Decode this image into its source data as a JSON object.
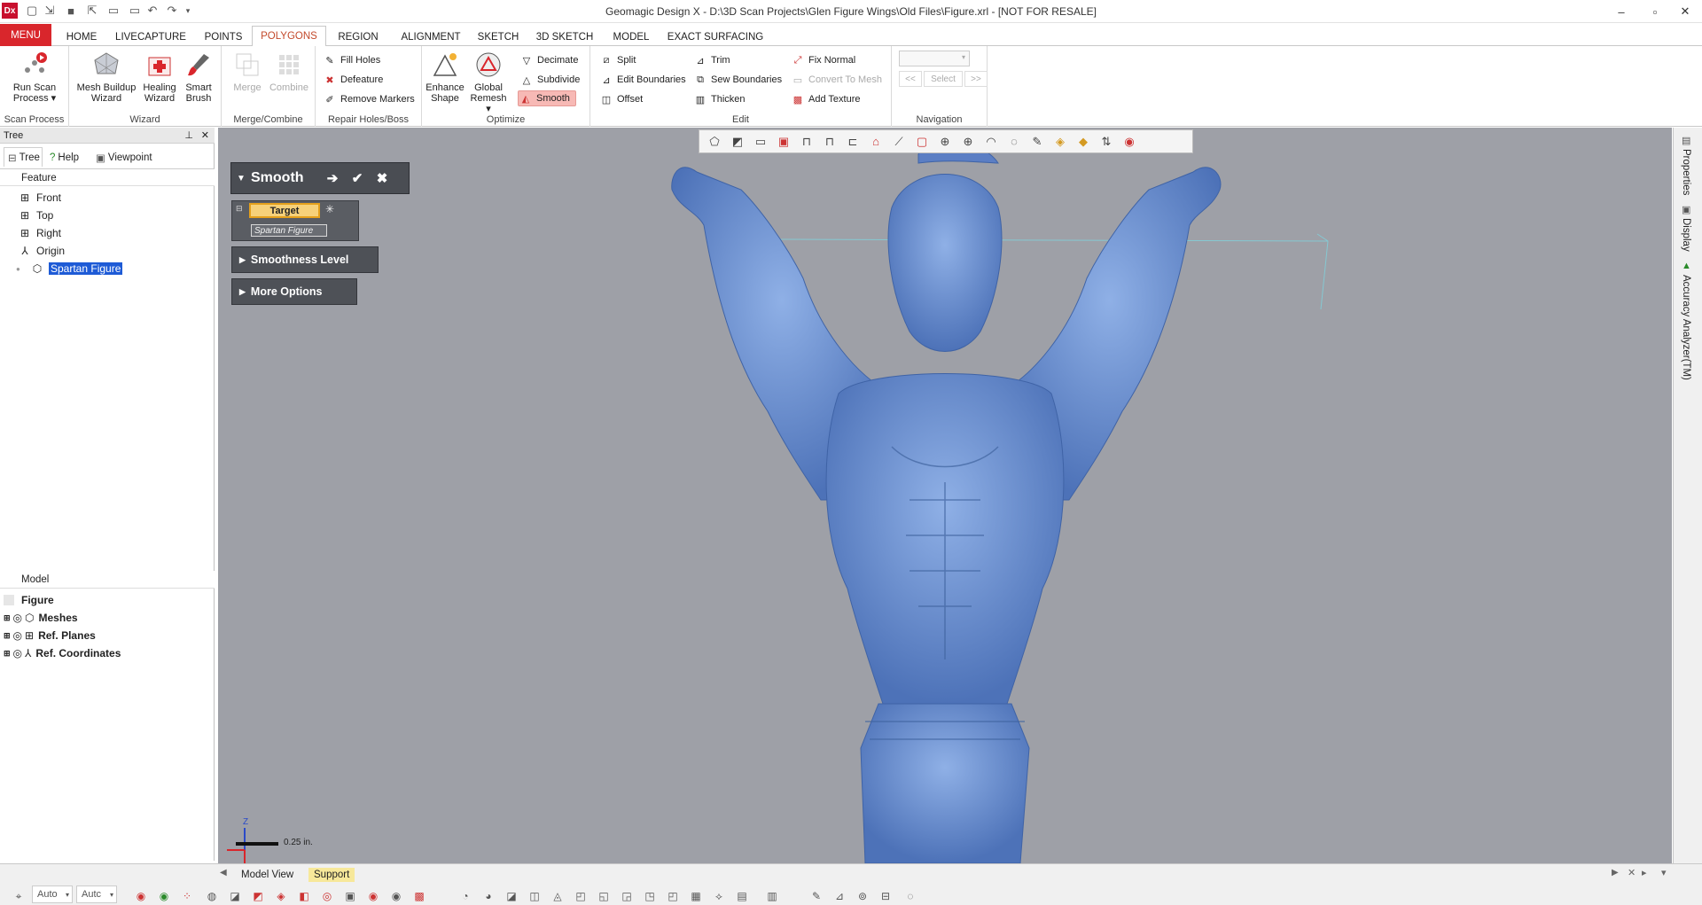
{
  "app": {
    "logo": "Dx",
    "title": "Geomagic Design X - D:\\3D Scan Projects\\Glen Figure Wings\\Old Files\\Figure.xrl - [NOT FOR RESALE]"
  },
  "window": {
    "min": "–",
    "max": "▫",
    "close": "✕"
  },
  "tabs": [
    "MENU",
    "HOME",
    "LIVECAPTURE",
    "POINTS",
    "POLYGONS",
    "REGION",
    "ALIGNMENT",
    "SKETCH",
    "3D SKETCH",
    "MODEL",
    "EXACT SURFACING"
  ],
  "active_tab": "POLYGONS",
  "ribbon": {
    "scan_process": {
      "label": "Scan Process",
      "run_scan": "Run Scan",
      "run_scan2": "Process ▾"
    },
    "wizard": {
      "label": "Wizard",
      "mesh_buildup": "Mesh Buildup",
      "mesh_buildup2": "Wizard",
      "healing": "Healing",
      "healing2": "Wizard",
      "smart_brush": "Smart",
      "smart_brush2": "Brush"
    },
    "merge": {
      "label": "Merge/Combine",
      "merge": "Merge",
      "combine": "Combine"
    },
    "repair": {
      "label": "Repair Holes/Boss",
      "fill_holes": "Fill Holes",
      "defeature": "Defeature",
      "remove_markers": "Remove Markers"
    },
    "optimize": {
      "label": "Optimize",
      "enhance": "Enhance",
      "enhance2": "Shape",
      "global_remesh": "Global",
      "global_remesh2": "Remesh ▾",
      "decimate": "Decimate",
      "subdivide": "Subdivide",
      "smooth": "Smooth"
    },
    "edit": {
      "label": "Edit",
      "split": "Split",
      "edit_boundaries": "Edit Boundaries",
      "offset": "Offset",
      "trim": "Trim",
      "sew_boundaries": "Sew Boundaries",
      "thicken": "Thicken",
      "fix_normal": "Fix Normal",
      "convert_to_mesh": "Convert To Mesh",
      "add_texture": "Add Texture"
    },
    "navigation": {
      "label": "Navigation",
      "prev": "<<",
      "select": "Select",
      "next": ">>"
    }
  },
  "left_panel": {
    "title": "Tree",
    "tabs": [
      "Tree",
      "Help",
      "Viewpoint"
    ],
    "feature_header": "Feature",
    "features": [
      "Front",
      "Top",
      "Right",
      "Origin",
      "Spartan Figure"
    ],
    "model_header": "Model",
    "model_root": "Figure",
    "model_items": [
      "Meshes",
      "Ref. Planes",
      "Ref. Coordinates"
    ]
  },
  "dialog": {
    "title": "Smooth",
    "target_label": "Target",
    "target_value": "Spartan Figure",
    "smoothness": "Smoothness Level",
    "more_options": "More Options"
  },
  "viewport": {
    "scale_label": "0.25 in.",
    "axis_z": "Z"
  },
  "bottom": {
    "tabs": [
      "Model View",
      "Support"
    ],
    "auto1": "Auto",
    "auto2": "Autc"
  },
  "right_dock": [
    "Properties",
    "Display",
    "Accuracy Analyzer(TM)"
  ],
  "colors": {
    "accent": "#d9262c",
    "viewport": "#9ea0a7",
    "mesh": "#6a8fcf"
  }
}
